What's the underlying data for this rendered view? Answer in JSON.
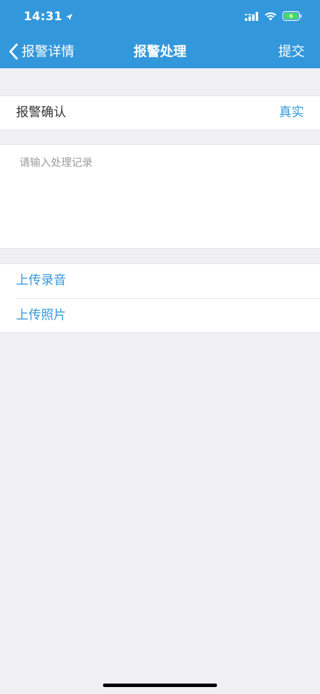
{
  "status_bar": {
    "time": "14:31"
  },
  "nav": {
    "back_label": "报警详情",
    "title": "报警处理",
    "submit_label": "提交"
  },
  "alarm_confirm": {
    "label": "报警确认",
    "value": "真实"
  },
  "record": {
    "placeholder": "请输入处理记录",
    "value": ""
  },
  "upload": {
    "audio_label": "上传录音",
    "photo_label": "上传照片"
  },
  "colors": {
    "accent": "#3398db",
    "header_bg": "#3398db",
    "page_bg": "#efeff4",
    "battery_fill": "#4cd964"
  },
  "icons": {
    "back": "chevron-left-icon",
    "location": "location-arrow-icon",
    "signal": "signal-icon",
    "wifi": "wifi-icon",
    "battery": "battery-charging-icon"
  }
}
